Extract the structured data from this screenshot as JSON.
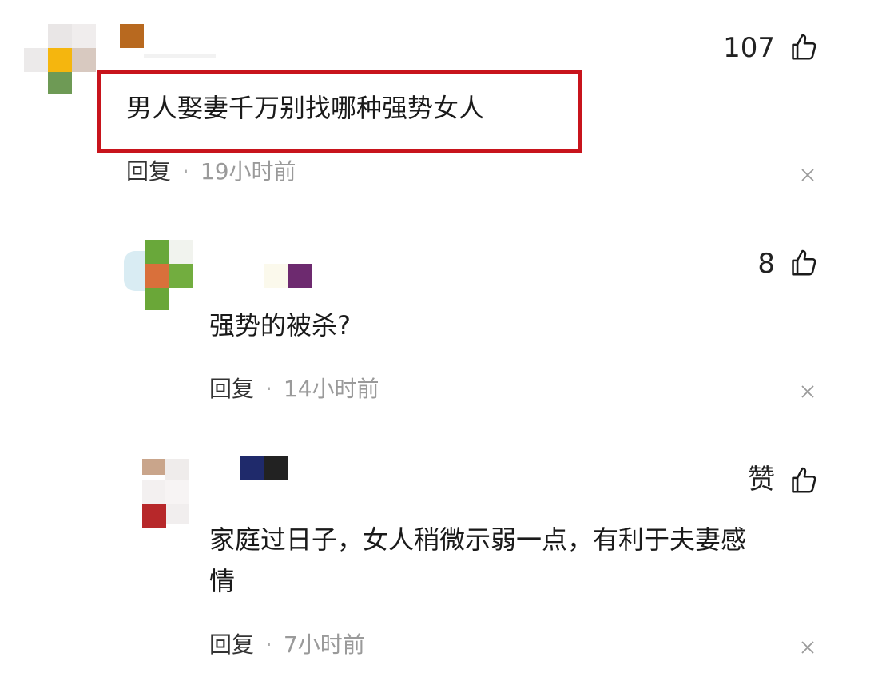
{
  "comments": [
    {
      "text": "男人娶妻千万别找哪种强势女人",
      "likes": "107",
      "reply_label": "回复",
      "separator": "·",
      "time": "19小时前",
      "highlighted": true,
      "highlight_color": "#c8141c"
    },
    {
      "text": "强势的被杀?",
      "likes": "8",
      "reply_label": "回复",
      "separator": "·",
      "time": "14小时前"
    },
    {
      "text_line1": "家庭过日子，女人稍微示弱一点，有利于夫妻感",
      "text_line2": "情",
      "likes": "赞",
      "reply_label": "回复",
      "separator": "·",
      "time": "7小时前"
    }
  ],
  "icons": {
    "like": "thumbs-up-icon",
    "close": "close-icon"
  }
}
